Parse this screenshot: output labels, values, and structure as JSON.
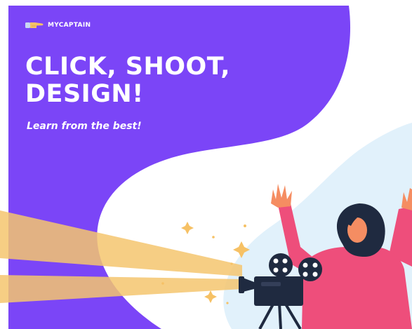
{
  "brand": {
    "name": "MYCAPTAIN",
    "logo_icon": "pointing-hand-icon"
  },
  "headline": {
    "line1": "CLICK, SHOOT,",
    "line2": "DESIGN!"
  },
  "tagline": "Learn from the best!",
  "illustration": {
    "subject": "woman-with-raised-arms-icon",
    "device": "film-camera-icon",
    "effects": [
      "light-beam-icon",
      "sparkle-icon"
    ]
  },
  "colors": {
    "panel": "#7B45F7",
    "blob": "#E1F1FB",
    "skin": "#F58D62",
    "shirt": "#EE4E7B",
    "hair": "#1F2A40",
    "beam": "#F5C56F",
    "camera": "#1F2A40",
    "sparkle": "#F6C165"
  }
}
